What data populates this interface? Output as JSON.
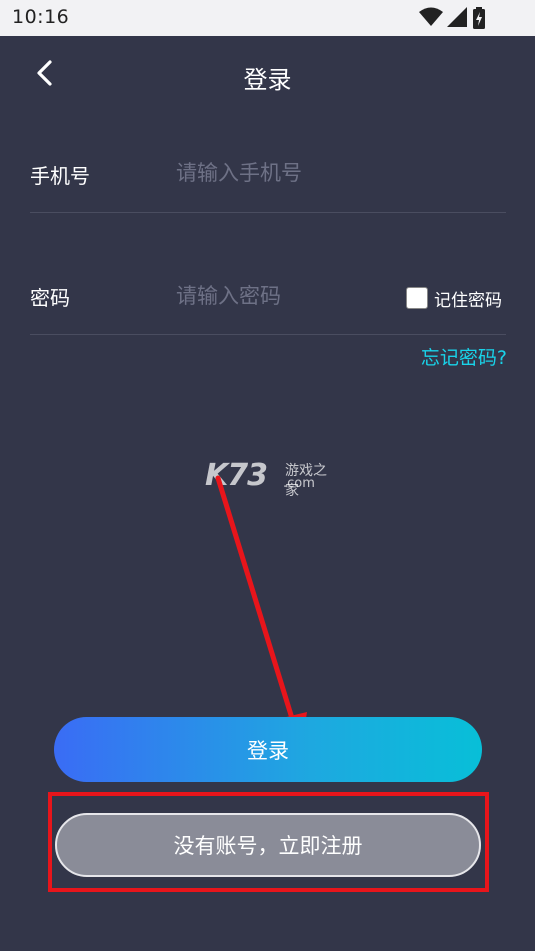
{
  "status_bar": {
    "time": "10:16",
    "icons": [
      "wifi-icon",
      "signal-icon",
      "battery-icon"
    ]
  },
  "header": {
    "title": "登录",
    "back_icon": "chevron-left-icon"
  },
  "form": {
    "phone": {
      "label": "手机号",
      "placeholder": "请输入手机号",
      "value": ""
    },
    "password": {
      "label": "密码",
      "placeholder": "请输入密码",
      "value": ""
    },
    "remember_password": {
      "label": "记住密码",
      "checked": false
    },
    "forgot_password": "忘记密码?"
  },
  "watermark": {
    "brand": "K73",
    "name": "游戏之家",
    "domain": ".com"
  },
  "actions": {
    "login_label": "登录",
    "register_label": "没有账号，立即注册"
  },
  "colors": {
    "background": "#333649",
    "accent_link": "#19d3e9",
    "login_gradient_start": "#3a6cf5",
    "login_gradient_end": "#08bfd8",
    "register_bg": "#8a8c98",
    "annotation_red": "#e8151b"
  }
}
